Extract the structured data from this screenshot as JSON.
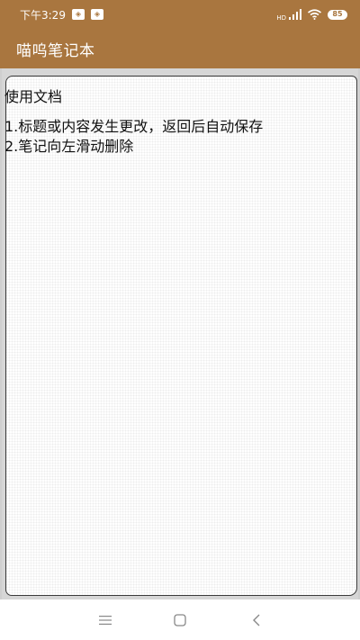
{
  "status_bar": {
    "time": "下午3:29",
    "notification_icons": [
      "app-notification-icon",
      "app-notification-icon"
    ],
    "network_label": "HD",
    "battery": "85"
  },
  "app_bar": {
    "title": "喵呜笔记本"
  },
  "note": {
    "title": "使用文档",
    "lines": [
      "1.标题或内容发生更改，返回后自动保存",
      "2.笔记向左滑动删除"
    ]
  },
  "nav_bar": {
    "icons": [
      "menu-icon",
      "home-icon",
      "back-icon"
    ]
  },
  "colors": {
    "brand": "#a9763f",
    "page_background": "#d6d6d6",
    "paper": "#ffffff",
    "text": "#111111"
  }
}
